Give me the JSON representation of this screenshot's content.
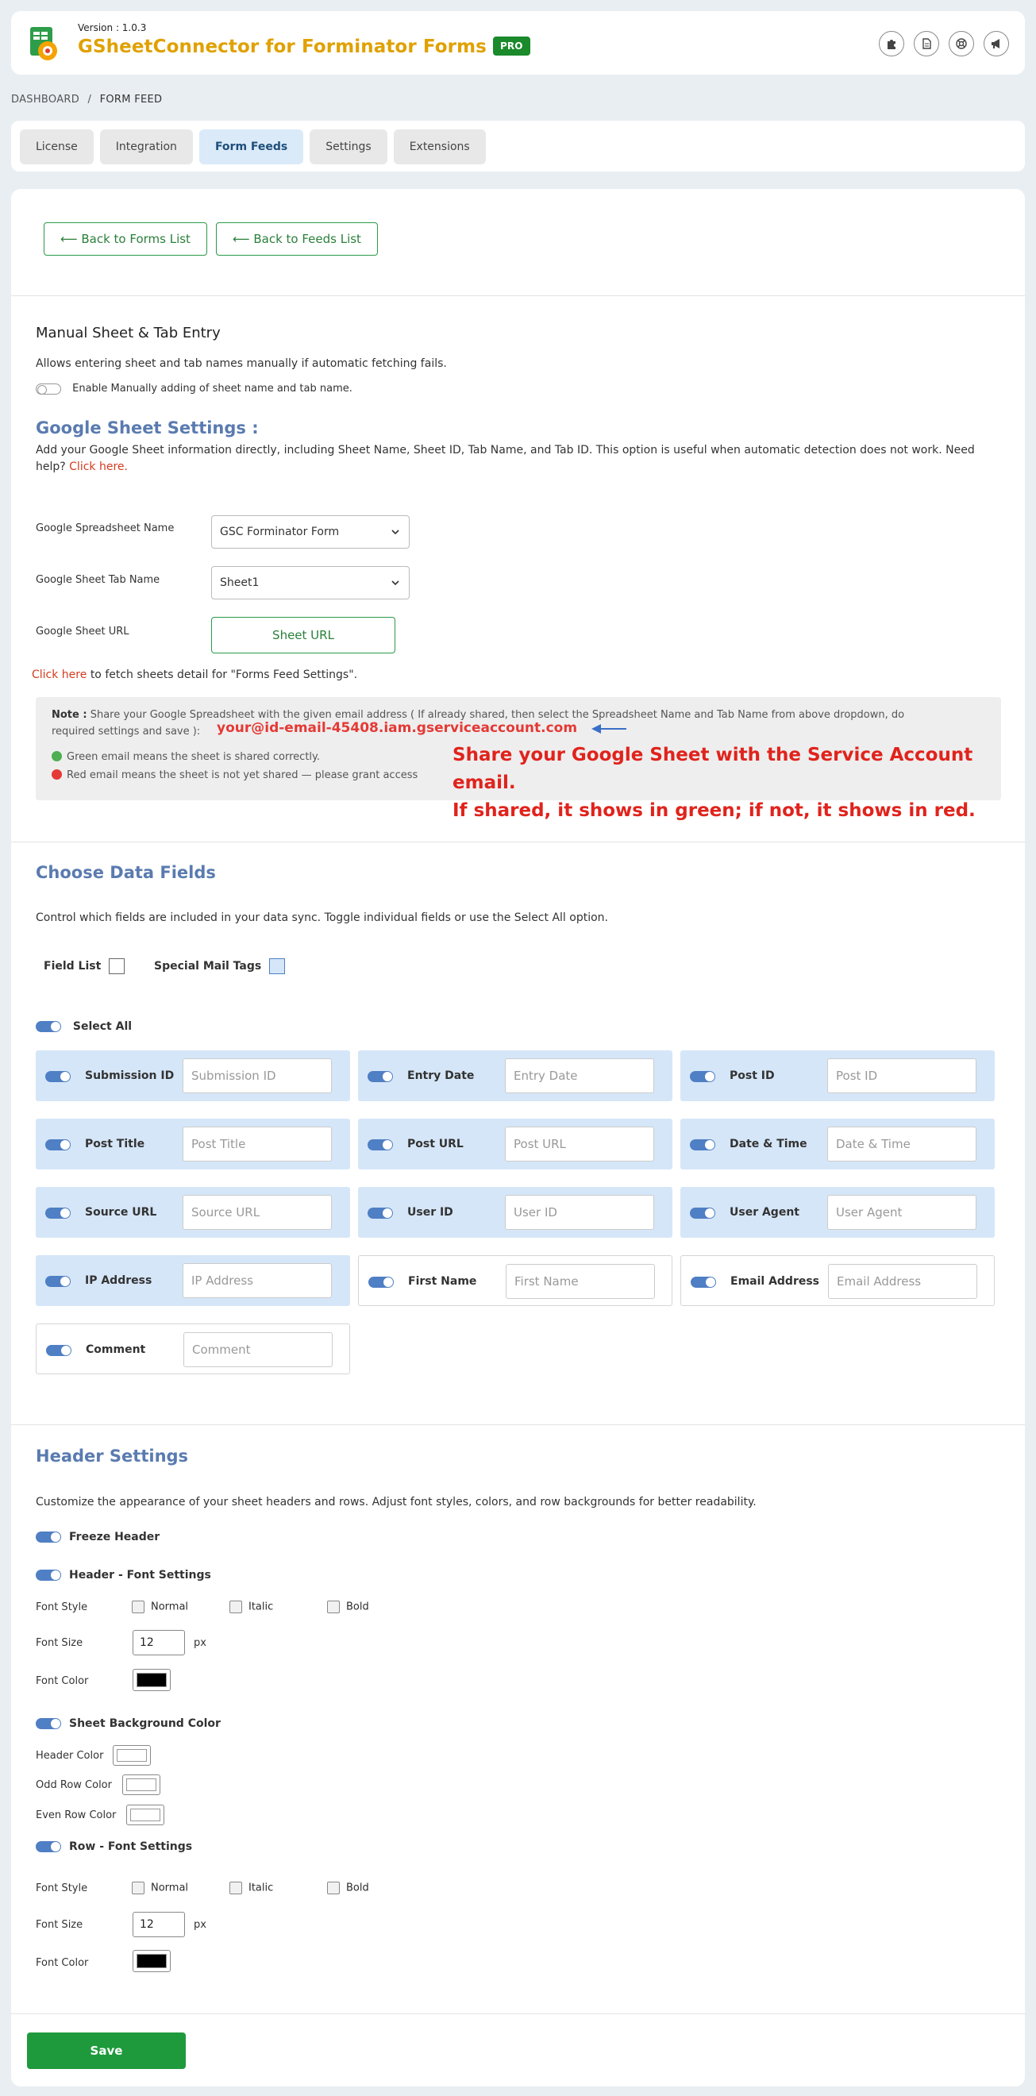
{
  "header": {
    "version": "Version : 1.0.3",
    "title": "GSheetConnector for Forminator Forms",
    "badge": "PRO",
    "icons": [
      "puzzle-icon",
      "document-icon",
      "support-icon",
      "megaphone-icon"
    ]
  },
  "breadcrumb": {
    "home": "DASHBOARD",
    "sep": "/",
    "current": "FORM FEED"
  },
  "tabs": [
    "License",
    "Integration",
    "Form Feeds",
    "Settings",
    "Extensions"
  ],
  "back": {
    "forms": "⟵ Back to Forms List",
    "feeds": "⟵ Back to Feeds List"
  },
  "manual": {
    "title": "Manual Sheet & Tab Entry",
    "desc": "Allows entering sheet and tab names manually if automatic fetching fails.",
    "toggle_label": "Enable Manually adding of sheet name and tab name."
  },
  "gsheet": {
    "title": "Google Sheet Settings :",
    "desc": "Add your Google Sheet information directly, including Sheet Name, Sheet ID, Tab Name, and Tab ID. This option is useful when automatic detection does not work. Need",
    "desc2": "help?",
    "help_link": "Click here.",
    "name_label": "Google Spreadsheet Name",
    "name_value": "GSC Forminator Form",
    "tab_label": "Google Sheet Tab Name",
    "tab_value": "Sheet1",
    "url_label": "Google Sheet URL",
    "url_button": "Sheet URL",
    "fetch_link": "Click here",
    "fetch_text": "to fetch sheets detail for \"Forms Feed Settings\"."
  },
  "note": {
    "label": "Note :",
    "text1": "Share your Google Spreadsheet with the given email address ( If already shared, then select the Spreadsheet Name and Tab Name from above dropdown, do",
    "text2": "required settings and save ):",
    "email": "your@id-email-45408.iam.gserviceaccount.com",
    "green": "Green email means the sheet is shared correctly.",
    "red": "Red email means the sheet is not yet shared — please grant access",
    "annot1": "Share your Google Sheet with the Service Account email.",
    "annot2": "If shared, it shows in green; if not, it shows in red.",
    "colors": {
      "green": "#4caf50",
      "red": "#e53935",
      "annot": "#e0231c"
    }
  },
  "fields": {
    "title": "Choose Data Fields",
    "desc": "Control which fields are included in your data sync. Toggle individual fields or use the Select All option.",
    "field_list": "Field List",
    "special_tags": "Special Mail Tags",
    "select_all": "Select All",
    "items": [
      {
        "label": "Submission ID",
        "placeholder": "Submission ID",
        "on": true
      },
      {
        "label": "Entry Date",
        "placeholder": "Entry Date",
        "on": true
      },
      {
        "label": "Post ID",
        "placeholder": "Post ID",
        "on": true
      },
      {
        "label": "Post Title",
        "placeholder": "Post Title",
        "on": true
      },
      {
        "label": "Post URL",
        "placeholder": "Post URL",
        "on": true
      },
      {
        "label": "Date & Time",
        "placeholder": "Date & Time",
        "on": true
      },
      {
        "label": "Source URL",
        "placeholder": "Source URL",
        "on": true
      },
      {
        "label": "User ID",
        "placeholder": "User ID",
        "on": true
      },
      {
        "label": "User Agent",
        "placeholder": "User Agent",
        "on": true
      },
      {
        "label": "IP Address",
        "placeholder": "IP Address",
        "on": true
      },
      {
        "label": "First Name",
        "placeholder": "First Name",
        "on": false
      },
      {
        "label": "Email Address",
        "placeholder": "Email Address",
        "on": false
      },
      {
        "label": "Comment",
        "placeholder": "Comment",
        "on": false
      }
    ]
  },
  "header_settings": {
    "title": "Header Settings",
    "desc": "Customize the appearance of your sheet headers and rows. Adjust font styles, colors, and row backgrounds for better readability.",
    "freeze": "Freeze Header",
    "header_font": "Header - Font Settings",
    "font_style": "Font Style",
    "normal": "Normal",
    "italic": "Italic",
    "bold": "Bold",
    "font_size": "Font Size",
    "size_value": "12",
    "px": "px",
    "font_color": "Font Color",
    "bg_color": "Sheet Background Color",
    "header_color": "Header Color",
    "odd_row": "Odd Row Color",
    "even_row": "Even Row Color",
    "row_font": "Row - Font Settings",
    "row_size_value": "12",
    "colors": {
      "font": "#000000",
      "header": "#ffffff",
      "odd": "#ffffff",
      "even": "#ffffff"
    }
  },
  "save": "Save"
}
